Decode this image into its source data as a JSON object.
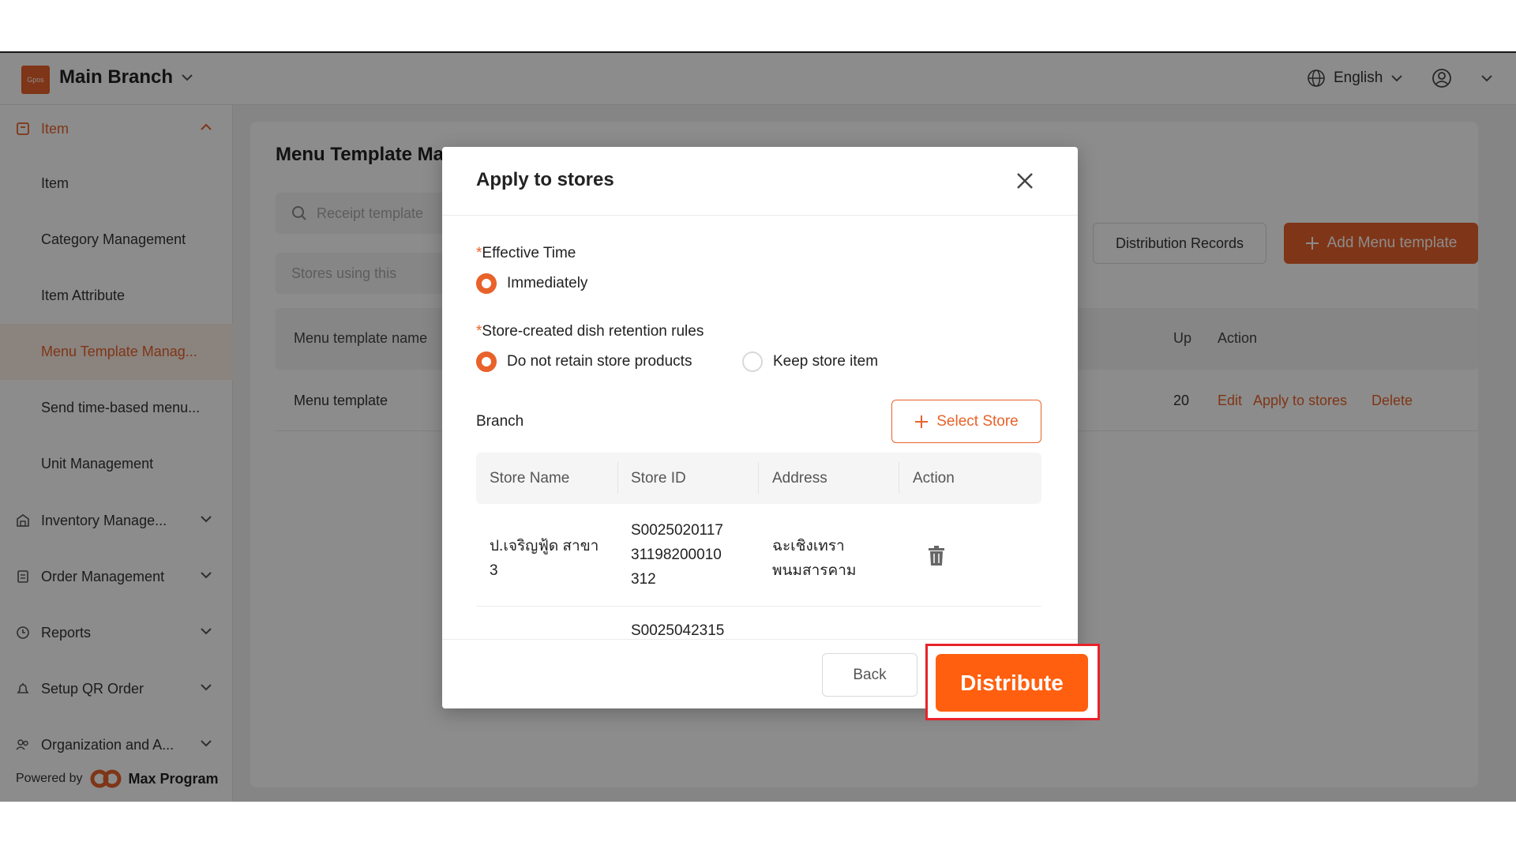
{
  "colors": {
    "accent": "#e8622a",
    "highlight": "#e8222a",
    "overlay": "rgba(0,0,0,0.45)"
  },
  "header": {
    "logo_text": "Gpos",
    "branch_name": "Main Branch",
    "language": "English"
  },
  "sidebar": {
    "group_item": "Item",
    "items": [
      {
        "label": "Item"
      },
      {
        "label": "Category Management"
      },
      {
        "label": "Item Attribute"
      },
      {
        "label": "Menu Template Manag..."
      },
      {
        "label": "Send time-based menu..."
      },
      {
        "label": "Unit Management"
      }
    ],
    "groups": [
      {
        "label": "Inventory Manage...",
        "icon": "warehouse-icon"
      },
      {
        "label": "Order Management",
        "icon": "clipboard-icon"
      },
      {
        "label": "Reports",
        "icon": "clock-icon"
      },
      {
        "label": "Setup QR Order",
        "icon": "bell-icon"
      },
      {
        "label": "Organization and A...",
        "icon": "users-icon"
      }
    ],
    "powered_by": "Powered by",
    "powered_brand": "Max Program"
  },
  "main": {
    "title": "Menu Template Ma",
    "search_placeholder": "Receipt template",
    "stores_filter_placeholder": "Stores using this",
    "distribution_records": "Distribution Records",
    "add_template": "Add Menu template",
    "table": {
      "col_name": "Menu template name",
      "col_updated": "Up",
      "col_action": "Action",
      "row": {
        "name": "Menu template",
        "updated": "20",
        "edit": "Edit",
        "apply": "Apply to stores",
        "delete": "Delete"
      }
    }
  },
  "modal": {
    "title": "Apply to stores",
    "effective_time_label": "Effective Time",
    "effective_time_option": "Immediately",
    "retention_label": "Store-created dish retention rules",
    "retention_option_1": "Do not retain store products",
    "retention_option_2": "Keep store item",
    "branch_label": "Branch",
    "select_store": "Select Store",
    "store_table": {
      "col_store_name": "Store Name",
      "col_store_id": "Store ID",
      "col_address": "Address",
      "col_action": "Action",
      "rows": [
        {
          "store_name": "ป.เจริญฟู้ด สาขา 3",
          "store_id": "S0025020117 31198200010 312",
          "address": "ฉะเชิงเทรา พนมสารคาม"
        },
        {
          "store_name": "",
          "store_id": "S0025042315",
          "address": ""
        }
      ]
    },
    "back": "Back",
    "distribute": "Distribute"
  }
}
